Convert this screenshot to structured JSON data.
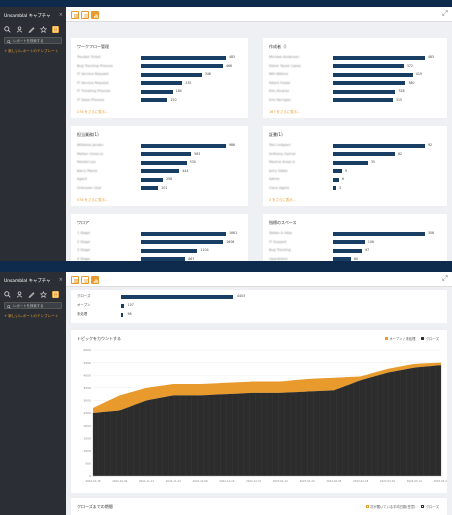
{
  "colors": {
    "accent": "#e89a2c",
    "bar": "#183f63",
    "sidebar": "#2b2f35",
    "chart_dark": "#2c2c2c",
    "chart_orange": "#e89a2c"
  },
  "sidebar": {
    "title": "Unsamblal キャプチャ",
    "close": "×",
    "icons": [
      "search-icon",
      "user-icon",
      "pencil-icon",
      "star-icon",
      "report-icon"
    ],
    "search_placeholder": "レポートを検索する",
    "new_report": "+ 新しいレポートのテンプレート"
  },
  "toolbar": {
    "view_buttons": [
      "grid-view-icon",
      "list-view-icon",
      "chart-view-icon"
    ],
    "expand_icon": "expand-icon"
  },
  "cards": [
    {
      "title": "ワークフロー管理",
      "rows": [
        {
          "label": "Trouble Ticket",
          "value": 483
        },
        {
          "label": "Bug Tracking Process",
          "value": 466
        },
        {
          "label": "IT Service Request",
          "value": 346
        },
        {
          "label": "IT Service Request",
          "value": 235
        },
        {
          "label": "IT Ticketing Process",
          "value": 180
        },
        {
          "label": "IT Sales Process",
          "value": 150
        }
      ],
      "more": "276 をさらに表示..."
    },
    {
      "title": "作成者（）",
      "rows": [
        {
          "label": "Michael Anderson",
          "value": 483
        },
        {
          "label": "Diane Taylor Lopez",
          "value": 372
        },
        {
          "label": "Will Wilkins",
          "value": 419
        },
        {
          "label": "Albert Foster",
          "value": 380
        },
        {
          "label": "Kim Alvarez",
          "value": 328
        },
        {
          "label": "Erin Kerrigan",
          "value": 315
        }
      ],
      "more": "167 をさらに表示..."
    },
    {
      "title": "担当業務(1)",
      "rows": [
        {
          "label": "Williams Jansen",
          "value": 986
        },
        {
          "label": "Melton Green Jr.",
          "value": 583
        },
        {
          "label": "Ronald Lee",
          "value": 530
        },
        {
          "label": "Barry Marks",
          "value": 444
        },
        {
          "label": "Agent",
          "value": 256
        },
        {
          "label": "Unknown User",
          "value": 201
        }
      ],
      "more": "576 をさらに表示..."
    },
    {
      "title": "証書(1)",
      "rows": [
        {
          "label": "Ted Lindgren",
          "value": 92
        },
        {
          "label": "Anthony Garner",
          "value": 62
        },
        {
          "label": "Maxine Ansel Jr.",
          "value": 35
        },
        {
          "label": "Jerry Gibbs",
          "value": 9
        },
        {
          "label": "Admin",
          "value": 6
        },
        {
          "label": "Clara Agent",
          "value": 3
        }
      ],
      "more": "3 をさらに表示..."
    },
    {
      "title": "ワロア",
      "rows": [
        {
          "label": "1 Stage",
          "value": 1661
        },
        {
          "label": "2 Stage",
          "value": 1608
        },
        {
          "label": "3 Stage",
          "value": 1104
        },
        {
          "label": "4 Stage",
          "value": 867
        }
      ],
      "more": ""
    },
    {
      "title": "指標のスペース",
      "rows": [
        {
          "label": "Tables & Help",
          "value": 306
        },
        {
          "label": "IT Support",
          "value": 106
        },
        {
          "label": "Bug Tracking",
          "value": 97
        },
        {
          "label": "Operations",
          "value": 60
        }
      ],
      "more": ""
    }
  ],
  "status": {
    "rows": [
      {
        "label": "クローズ",
        "value": 4403
      },
      {
        "label": "オープン",
        "value": 107
      },
      {
        "label": "未処理",
        "value": 98
      }
    ]
  },
  "chart_data": {
    "type": "area",
    "title": "トピックをカウントする",
    "legend": [
      {
        "label": "オープン / 未処理",
        "color": "#e89a2c"
      },
      {
        "label": "クローズ",
        "color": "#2c2c2c"
      }
    ],
    "legend_position": "top-right",
    "grid": true,
    "ylim": [
      0,
      5000
    ],
    "yticks": [
      0,
      500,
      1000,
      1500,
      2000,
      2500,
      3000,
      3500,
      4000,
      4500,
      5000
    ],
    "xticks": [
      "2022-10-18",
      "2022-10-30",
      "2022-11-12",
      "2022-11-24",
      "2022-12-06",
      "2022-12-19",
      "2022-12-31",
      "2023-01-12",
      "2023-01-24",
      "2023-02-05",
      "2023-02-18",
      "2023-03-02",
      "2023-03-14",
      "2023-03-27"
    ],
    "series": [
      {
        "name": "クローズ",
        "values": [
          2500,
          2600,
          3000,
          3200,
          3200,
          3250,
          3300,
          3300,
          3350,
          3400,
          3800,
          4100,
          4300,
          4400
        ]
      },
      {
        "name": "オープン / 未処理",
        "values": [
          200,
          600,
          500,
          450,
          450,
          450,
          450,
          450,
          500,
          500,
          150,
          150,
          150,
          100
        ]
      }
    ]
  },
  "bottom": {
    "title": "クローズまでの期間",
    "legend": [
      "次が開いている平均日数(任意)",
      "クローズ"
    ]
  }
}
